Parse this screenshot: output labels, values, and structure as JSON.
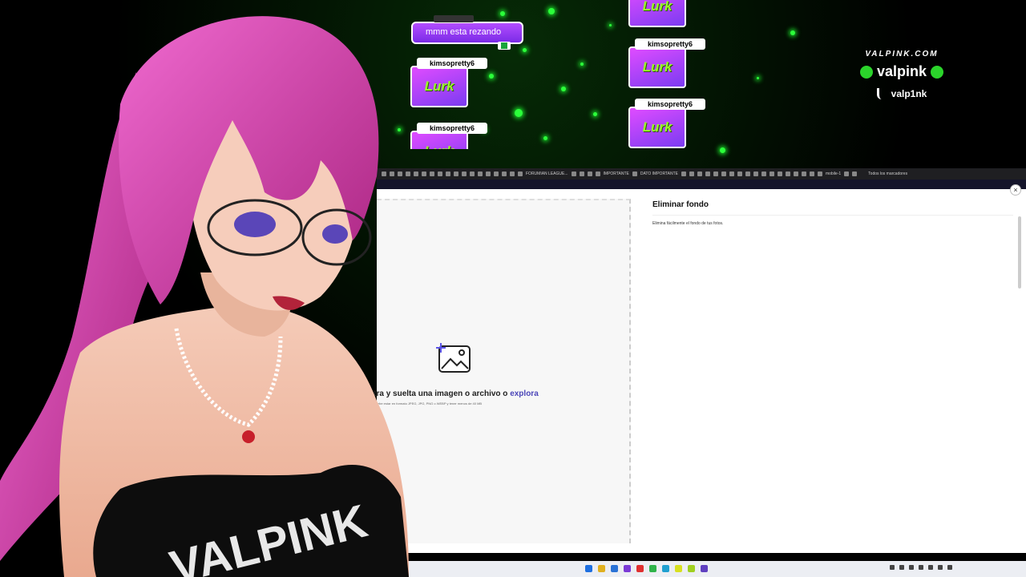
{
  "overlay": {
    "chat_message": "mmm esta rezando",
    "lurk_label": "Lurk",
    "lurk_cards": [
      {
        "user": "kimsopretty6"
      },
      {
        "user": "kimsopretty6"
      },
      {
        "user": "kimsopretty6"
      },
      {
        "user": "kimsopretty6"
      },
      {
        "user": "kimsopretty6"
      }
    ],
    "brand_url": "VALPINK.COM",
    "brand_name": "valpink",
    "brand_tiktok": "valp1nk",
    "avatar_shirt_text": "VALPINK"
  },
  "browser": {
    "bookmarks": [
      "FORUMIAN LEAGUE...",
      "IMPORTANTE",
      "DATO IMPORTANTE",
      "mobile-1",
      "Todos los marcadores"
    ],
    "panel_title": "Eliminar fondo",
    "panel_desc": "Elimina fácilmente el fondo de tus fotos.",
    "drop_text": "Arrastra y suelta una imagen o archivo o ",
    "drop_link": "explora",
    "drop_hint": "El archivo debe estar en formato JPEG, JPG, PNG o WEBP y tener menos de 40 MB",
    "close_label": "×"
  },
  "colors": {
    "accent_link": "#4b46b8",
    "lurk_card": "#b34dff",
    "lurk_text": "#9bff2a",
    "particles": "#2bff3a",
    "hair": "#e03bb4"
  }
}
